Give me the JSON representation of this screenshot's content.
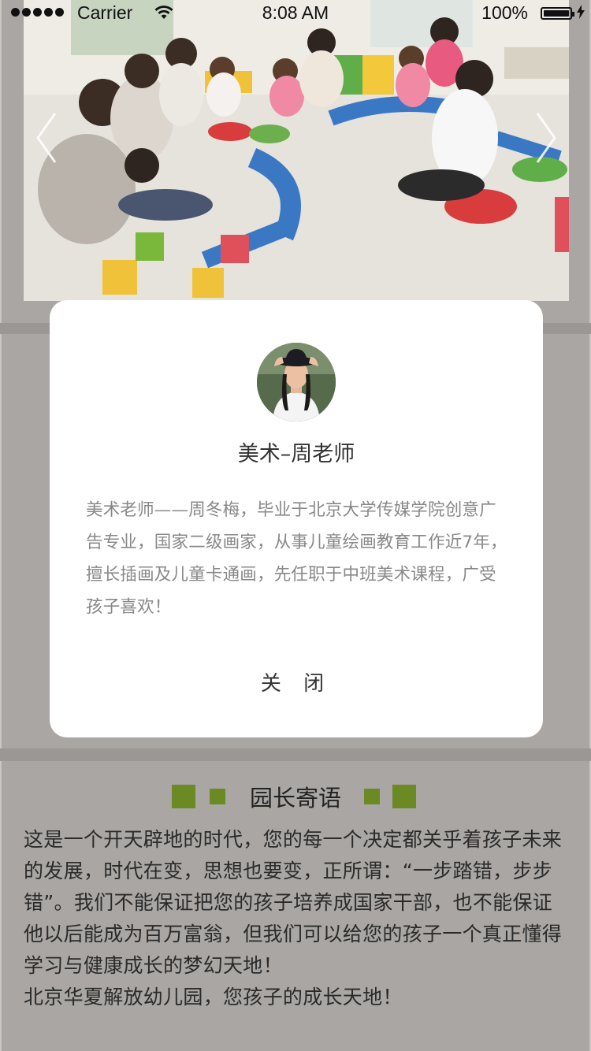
{
  "status_bar": {
    "carrier": "Carrier",
    "time": "8:08 AM",
    "battery": "100%",
    "battery_level": 1.0
  },
  "hero": {
    "image": "children-classroom-photo"
  },
  "teacher_modal": {
    "name": "美术–周老师",
    "description": "美术老师——周冬梅，毕业于北京大学传媒学院创意广告专业，国家二级画家，从事儿童绘画教育工作近7年，擅长插画及儿童卡通画，先任职于中班美术课程，广受孩子喜欢！",
    "close_label": "关 闭"
  },
  "director_section": {
    "title": "园长寄语",
    "accent_color": "#6b8a23",
    "paragraph": "这是一个开天辟地的时代，您的每一个决定都关乎着孩子未来的发展，时代在变，思想也要变，正所谓：“一步踏错，步步错”。我们不能保证把您的孩子培养成国家干部，也不能保证他以后能成为百万富翁，但我们可以给您的孩子一个真正懂得学习与健康成长的梦幻天地！",
    "closing": "北京华夏解放幼儿园，您孩子的成长天地！"
  }
}
